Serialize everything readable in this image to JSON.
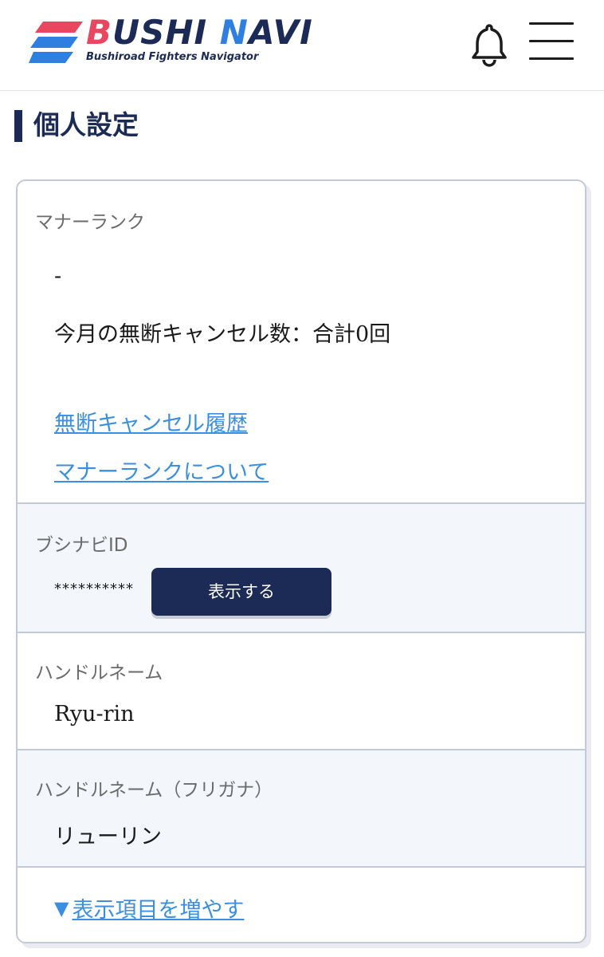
{
  "header": {
    "logo_title_b": "B",
    "logo_title_ushi": "USHI ",
    "logo_title_n": "N",
    "logo_title_avi": "AVI",
    "logo_subtitle": "Bushiroad Fighters Navigator",
    "icons": {
      "bell": "bell-icon",
      "menu": "hamburger-menu-icon"
    },
    "colors": {
      "brand_navy": "#1c2a56",
      "brand_red": "#e8475f",
      "brand_blue": "#2f7fe0"
    }
  },
  "page": {
    "title": "個人設定"
  },
  "manner_rank": {
    "label": "マナーランク",
    "rank_value": "-",
    "cancel_count": "今月の無断キャンセル数：合計0回",
    "history_link": "無断キャンセル履歴",
    "about_link": "マナーランクについて"
  },
  "bushinavi_id": {
    "label": "ブシナビID",
    "masked_value": "**********",
    "show_button": "表示する"
  },
  "handle_name": {
    "label": "ハンドルネーム",
    "value": "Ryu-rin"
  },
  "handle_name_kana": {
    "label": "ハンドルネーム（フリガナ）",
    "value": "リューリン"
  },
  "expand": {
    "icon": "▼",
    "label": "表示項目を増やす"
  },
  "colors": {
    "link": "#3b8fe0",
    "border": "#c2cad9",
    "alt_row_bg": "#f3f6fb",
    "button_bg": "#1c2a56"
  }
}
